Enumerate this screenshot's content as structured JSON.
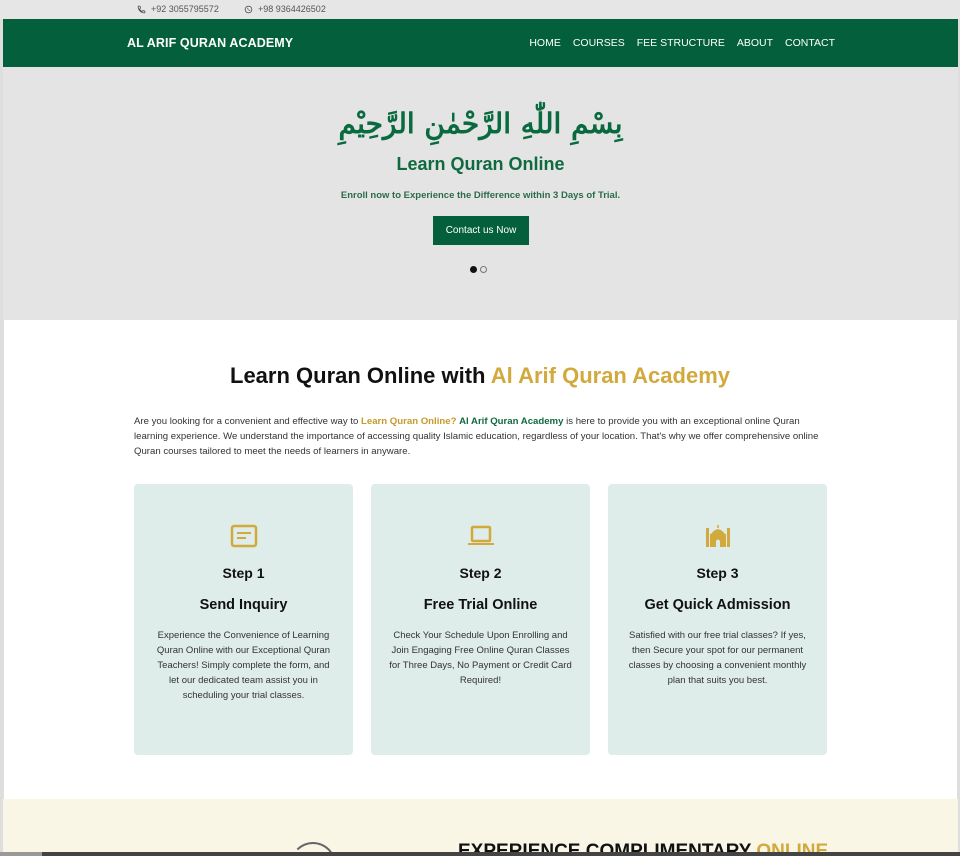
{
  "topbar": {
    "phone": "+92 3055795572",
    "whatsapp": "+98 9364426502",
    "phone_icon": "phone-icon",
    "whatsapp_icon": "whatsapp-icon"
  },
  "navbar": {
    "brand": "AL ARIF QURAN ACADEMY",
    "links": [
      "HOME",
      "COURSES",
      "FEE STRUCTURE",
      "ABOUT",
      "CONTACT"
    ]
  },
  "hero": {
    "bismillah": "بِسْمِ اللّٰهِ الرَّحْمٰنِ الرَّحِيْمِ",
    "title": "Learn Quran Online",
    "subtitle": "Enroll now to Experience the Difference within 3 Days of Trial.",
    "button": "Contact us Now",
    "slides": 2,
    "active_slide": 1
  },
  "section": {
    "title_main": "Learn Quran Online with ",
    "title_accent": "Al Arif Quran Academy",
    "intro_1": "Are you looking for a convenient and effective way to ",
    "intro_link_1": "Learn Quran Online?",
    "intro_2": " ",
    "intro_link_2": "Al Arif Quran Academy",
    "intro_3": " is here to provide you with an exceptional online Quran learning experience. We understand the importance of accessing quality Islamic education, regardless of your location. That's why we offer comprehensive online Quran courses tailored to meet the needs of learners in anyware."
  },
  "cards": [
    {
      "icon": "form-icon",
      "step": "Step 1",
      "title": "Send Inquiry",
      "desc": "Experience the Convenience of Learning Quran Online with our Exceptional Quran Teachers! Simply complete the form, and let our dedicated team assist you in scheduling your trial classes."
    },
    {
      "icon": "laptop-icon",
      "step": "Step 2",
      "title": "Free Trial Online",
      "desc": "Check Your Schedule Upon Enrolling and Join Engaging Free Online Quran Classes for Three Days, No Payment or Credit Card Required!"
    },
    {
      "icon": "mosque-icon",
      "step": "Step 3",
      "title": "Get Quick Admission",
      "desc": "Satisfied with our free trial classes? If yes, then Secure your spot for our permanent classes by choosing a convenient monthly plan that suits you best."
    }
  ],
  "bottom": {
    "title_main": "EXPERIENCE COMPLIMENTARY ",
    "title_accent": "ONLINE"
  },
  "colors": {
    "brand_green": "#04603c",
    "accent_gold": "#d2a93c",
    "card_bg": "#deecea",
    "hero_bg": "#e4e4e4"
  }
}
